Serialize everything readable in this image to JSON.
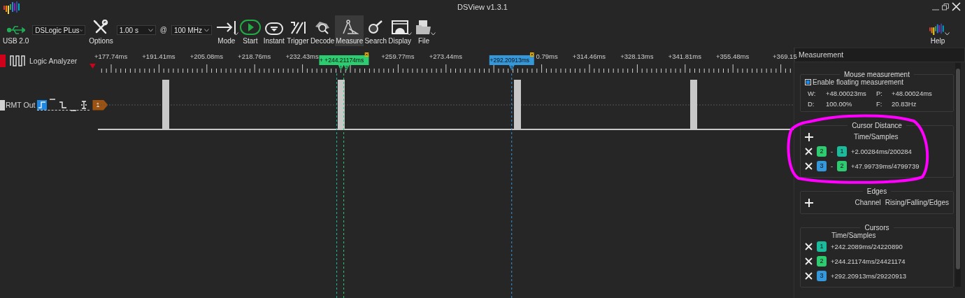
{
  "window": {
    "title": "DSView v1.3.1"
  },
  "toolbar": {
    "items": [
      {
        "kind": "usb",
        "label": "USB 2.0",
        "selected": false,
        "menu": false
      },
      {
        "kind": "select",
        "value": "DSLogic PLus"
      },
      {
        "kind": "options",
        "label": "Options",
        "selected": false,
        "menu": false
      },
      {
        "kind": "select",
        "value": "1.00 s"
      },
      {
        "kind": "at",
        "text": "@"
      },
      {
        "kind": "select",
        "value": "100 MHz"
      },
      {
        "kind": "mode",
        "label": "Mode",
        "selected": false,
        "menu": true
      },
      {
        "kind": "start",
        "label": "Start",
        "selected": false,
        "menu": false
      },
      {
        "kind": "instant",
        "label": "Instant",
        "selected": false,
        "menu": false
      },
      {
        "kind": "trigger",
        "label": "Trigger",
        "selected": false,
        "menu": false
      },
      {
        "kind": "decode",
        "label": "Decode",
        "selected": false,
        "menu": false
      },
      {
        "kind": "measure",
        "label": "Measure",
        "selected": true,
        "menu": false
      },
      {
        "kind": "search",
        "label": "Search",
        "selected": false,
        "menu": false
      },
      {
        "kind": "display",
        "label": "Display",
        "selected": false,
        "menu": true
      },
      {
        "kind": "file",
        "label": "File",
        "selected": false,
        "menu": true
      }
    ],
    "help": {
      "label": "Help",
      "menu": true
    }
  },
  "device_header": {
    "label": "Logic Analyzer"
  },
  "ruler": {
    "items": [
      {
        "kind": "label",
        "text": "+177.74ms"
      },
      {
        "kind": "label",
        "text": "+191.41ms"
      },
      {
        "kind": "label",
        "text": "+205.08ms"
      },
      {
        "kind": "label",
        "text": "+218.76ms"
      },
      {
        "kind": "label",
        "text": "+232.43ms"
      },
      {
        "kind": "flag",
        "text": "+ +244.21174ms",
        "color": "#2ecc71",
        "markers": [
          "1",
          "2"
        ]
      },
      {
        "kind": "label",
        "text": "+259.77ms"
      },
      {
        "kind": "label",
        "text": "+273.44ms"
      },
      {
        "kind": "flag",
        "text": "+292.20913ms",
        "color": "#3498db",
        "markers": [
          "3"
        ]
      },
      {
        "kind": "label",
        "text": "0.79ms"
      },
      {
        "kind": "label",
        "text": "+314.46ms"
      },
      {
        "kind": "label",
        "text": "+328.13ms"
      },
      {
        "kind": "label",
        "text": "+341.81ms"
      },
      {
        "kind": "label",
        "text": "+355.48ms"
      },
      {
        "kind": "label",
        "text": "+369.15"
      }
    ]
  },
  "channels": [
    {
      "name": "RMT Out",
      "tag": "1",
      "triggers": [
        {
          "kind": "rising",
          "selected": true
        },
        {
          "kind": "high",
          "selected": false
        },
        {
          "kind": "falling",
          "selected": false
        },
        {
          "kind": "low",
          "selected": false
        },
        {
          "kind": "edge",
          "selected": false
        }
      ]
    }
  ],
  "panel": {
    "title": "Measurement",
    "mouse": {
      "title": "Mouse measurement",
      "floating": {
        "label": "Enable floating measurement",
        "checked": true
      },
      "values": [
        {
          "key": "W:",
          "value": "+48.00023ms"
        },
        {
          "key": "P:",
          "value": "+48.00024ms"
        },
        {
          "key": "D:",
          "value": "100.00%"
        },
        {
          "key": "F:",
          "value": "20.83Hz"
        }
      ]
    },
    "cursor_distance": {
      "title": "Cursor Distance",
      "column": "Time/Samples",
      "rows": [
        {
          "from": {
            "index": "2",
            "color": "#2ecc71"
          },
          "separator": "-",
          "to": {
            "index": "1",
            "color": "#1abc9c"
          },
          "value": "+2.00284ms/200284"
        },
        {
          "from": {
            "index": "3",
            "color": "#3498db"
          },
          "separator": "-",
          "to": {
            "index": "2",
            "color": "#2ecc71"
          },
          "value": "+47.99739ms/4799739"
        }
      ]
    },
    "edges": {
      "title": "Edges",
      "columns": [
        "Channel",
        "Rising/Falling/Edges"
      ]
    },
    "cursors": {
      "title": "Cursors",
      "column": "Time/Samples",
      "rows": [
        {
          "index": "1",
          "color": "#1abc9c",
          "value": "+242.2089ms/24220890"
        },
        {
          "index": "2",
          "color": "#2ecc71",
          "value": "+244.21174ms/24421174"
        },
        {
          "index": "3",
          "color": "#3498db",
          "value": "+292.20913ms/29220913"
        }
      ]
    }
  }
}
